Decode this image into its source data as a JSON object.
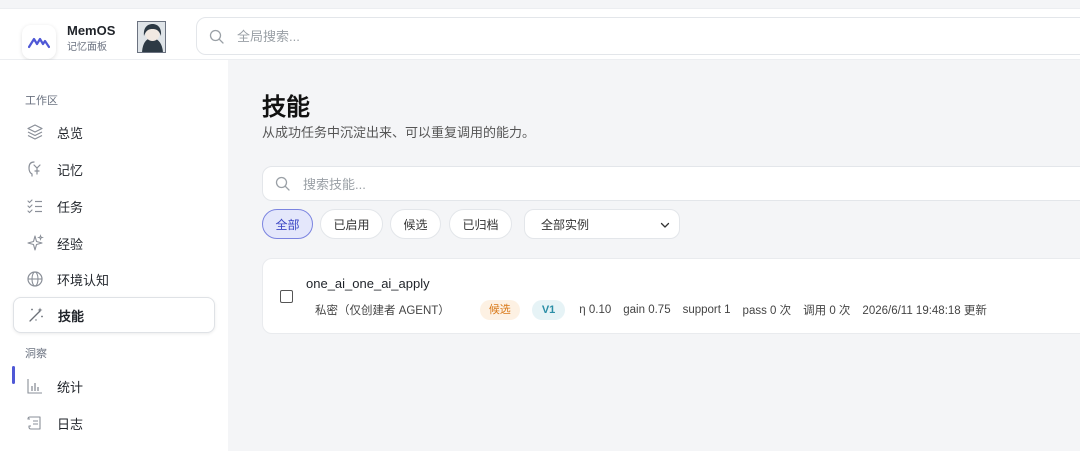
{
  "app": {
    "name": "MemOS",
    "subtitle": "记忆面板"
  },
  "header": {
    "search_placeholder": "全局搜索..."
  },
  "sidebar": {
    "section_workspace": "工作区",
    "section_insight": "洞察",
    "items": [
      {
        "label": "总览",
        "icon": "layers-icon"
      },
      {
        "label": "记忆",
        "icon": "memory-icon"
      },
      {
        "label": "任务",
        "icon": "task-list-icon"
      },
      {
        "label": "经验",
        "icon": "sparkle-icon"
      },
      {
        "label": "环境认知",
        "icon": "globe-icon"
      },
      {
        "label": "技能",
        "icon": "magic-wand-icon",
        "active": true
      },
      {
        "label": "统计",
        "icon": "bar-chart-icon"
      },
      {
        "label": "日志",
        "icon": "scroll-icon"
      }
    ]
  },
  "page": {
    "title": "技能",
    "subtitle": "从成功任务中沉淀出来、可以重复调用的能力。",
    "search_placeholder": "搜索技能..."
  },
  "filters": {
    "chips": [
      {
        "label": "全部",
        "active": true
      },
      {
        "label": "已启用"
      },
      {
        "label": "候选"
      },
      {
        "label": "已归档"
      }
    ],
    "instance_select": "全部实例"
  },
  "skills": [
    {
      "name": "one_ai_one_ai_apply",
      "visibility": "私密（仅创建者 AGENT）",
      "status": "候选",
      "version": "V1",
      "eta": "η 0.10",
      "gain": "gain 0.75",
      "support": "support 1",
      "pass": "pass 0 次",
      "calls": "调用 0 次",
      "updated": "2026/6/11 19:48:18 更新"
    }
  ],
  "colors": {
    "accent": "#4f58d6",
    "candidate": "#d97a1a",
    "version": "#2a8ea6"
  }
}
